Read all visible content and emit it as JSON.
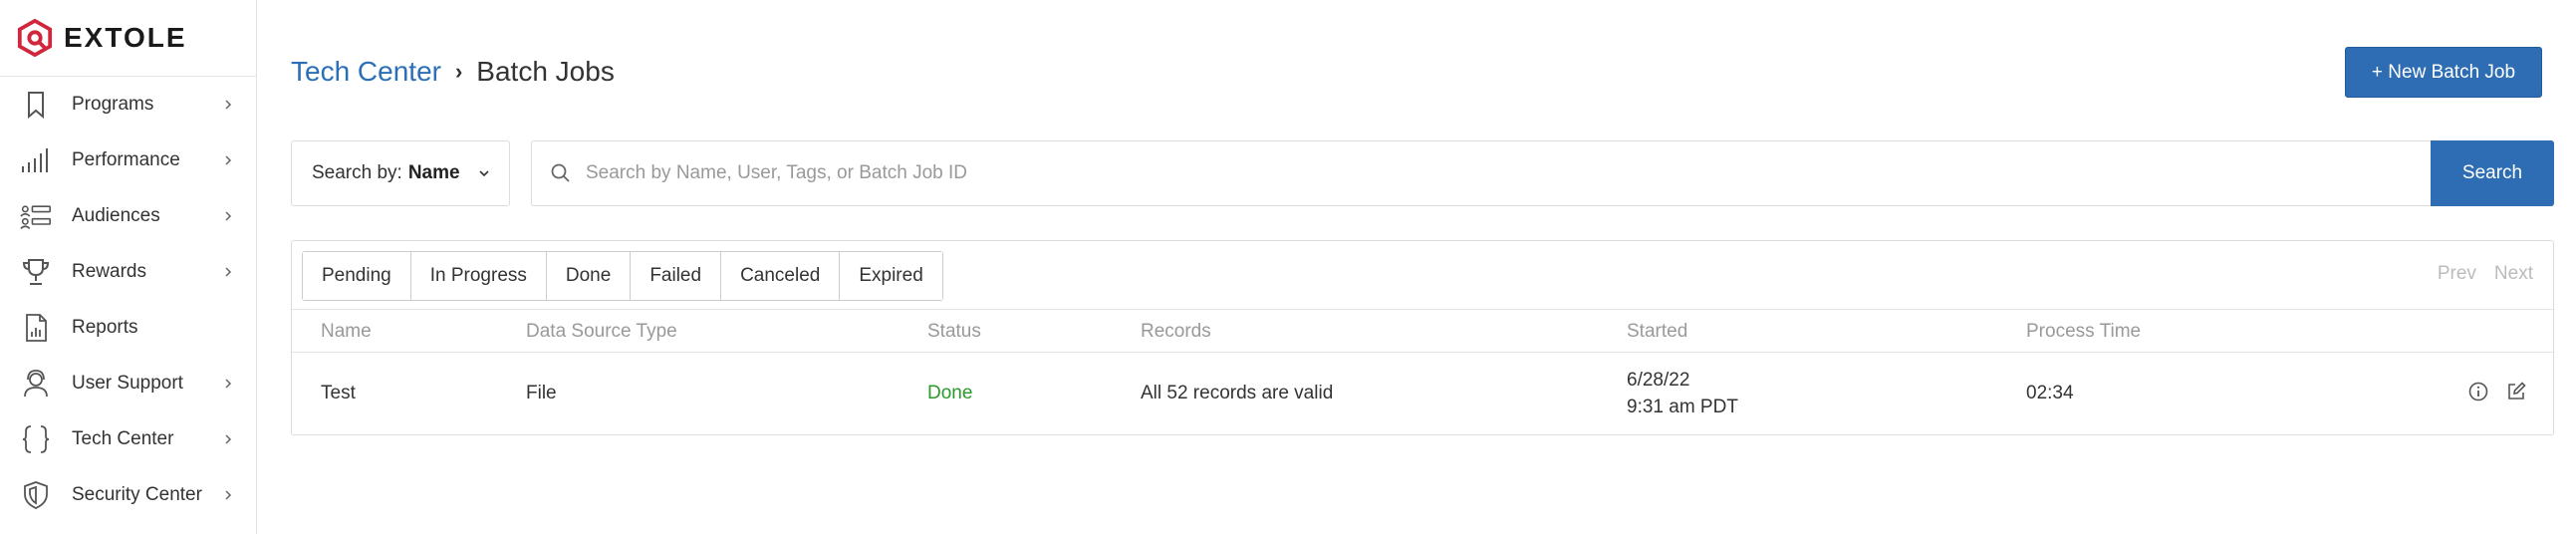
{
  "brand": {
    "name": "EXTOLE",
    "accent": "#d0273d"
  },
  "sidebar": {
    "items": [
      {
        "label": "Programs",
        "icon": "bookmark-icon",
        "has_chevron": true
      },
      {
        "label": "Performance",
        "icon": "bar-chart-icon",
        "has_chevron": true
      },
      {
        "label": "Audiences",
        "icon": "audience-list-icon",
        "has_chevron": true
      },
      {
        "label": "Rewards",
        "icon": "trophy-icon",
        "has_chevron": true
      },
      {
        "label": "Reports",
        "icon": "report-document-icon",
        "has_chevron": false
      },
      {
        "label": "User Support",
        "icon": "headset-user-icon",
        "has_chevron": true
      },
      {
        "label": "Tech Center",
        "icon": "braces-icon",
        "has_chevron": true
      },
      {
        "label": "Security Center",
        "icon": "shield-icon",
        "has_chevron": true
      }
    ]
  },
  "header": {
    "breadcrumb_parent": "Tech Center",
    "breadcrumb_separator": "›",
    "breadcrumb_current": "Batch Jobs",
    "new_button": "+ New Batch Job"
  },
  "search": {
    "by_prefix": "Search by:",
    "by_value": "Name",
    "placeholder": "Search by Name, User, Tags, or Batch Job ID",
    "value": "",
    "button": "Search"
  },
  "filters": {
    "tabs": [
      "Pending",
      "In Progress",
      "Done",
      "Failed",
      "Canceled",
      "Expired"
    ],
    "prev": "Prev",
    "next": "Next"
  },
  "table": {
    "columns": [
      "Name",
      "Data Source Type",
      "Status",
      "Records",
      "Started",
      "Process Time"
    ],
    "rows": [
      {
        "name": "Test",
        "data_source_type": "File",
        "status": "Done",
        "records": "All 52 records are valid",
        "started_date": "6/28/22",
        "started_time": "9:31 am PDT",
        "process_time": "02:34"
      }
    ]
  },
  "colors": {
    "primary": "#2e6db4",
    "link": "#2a6fb8",
    "done": "#2a9a2a"
  }
}
